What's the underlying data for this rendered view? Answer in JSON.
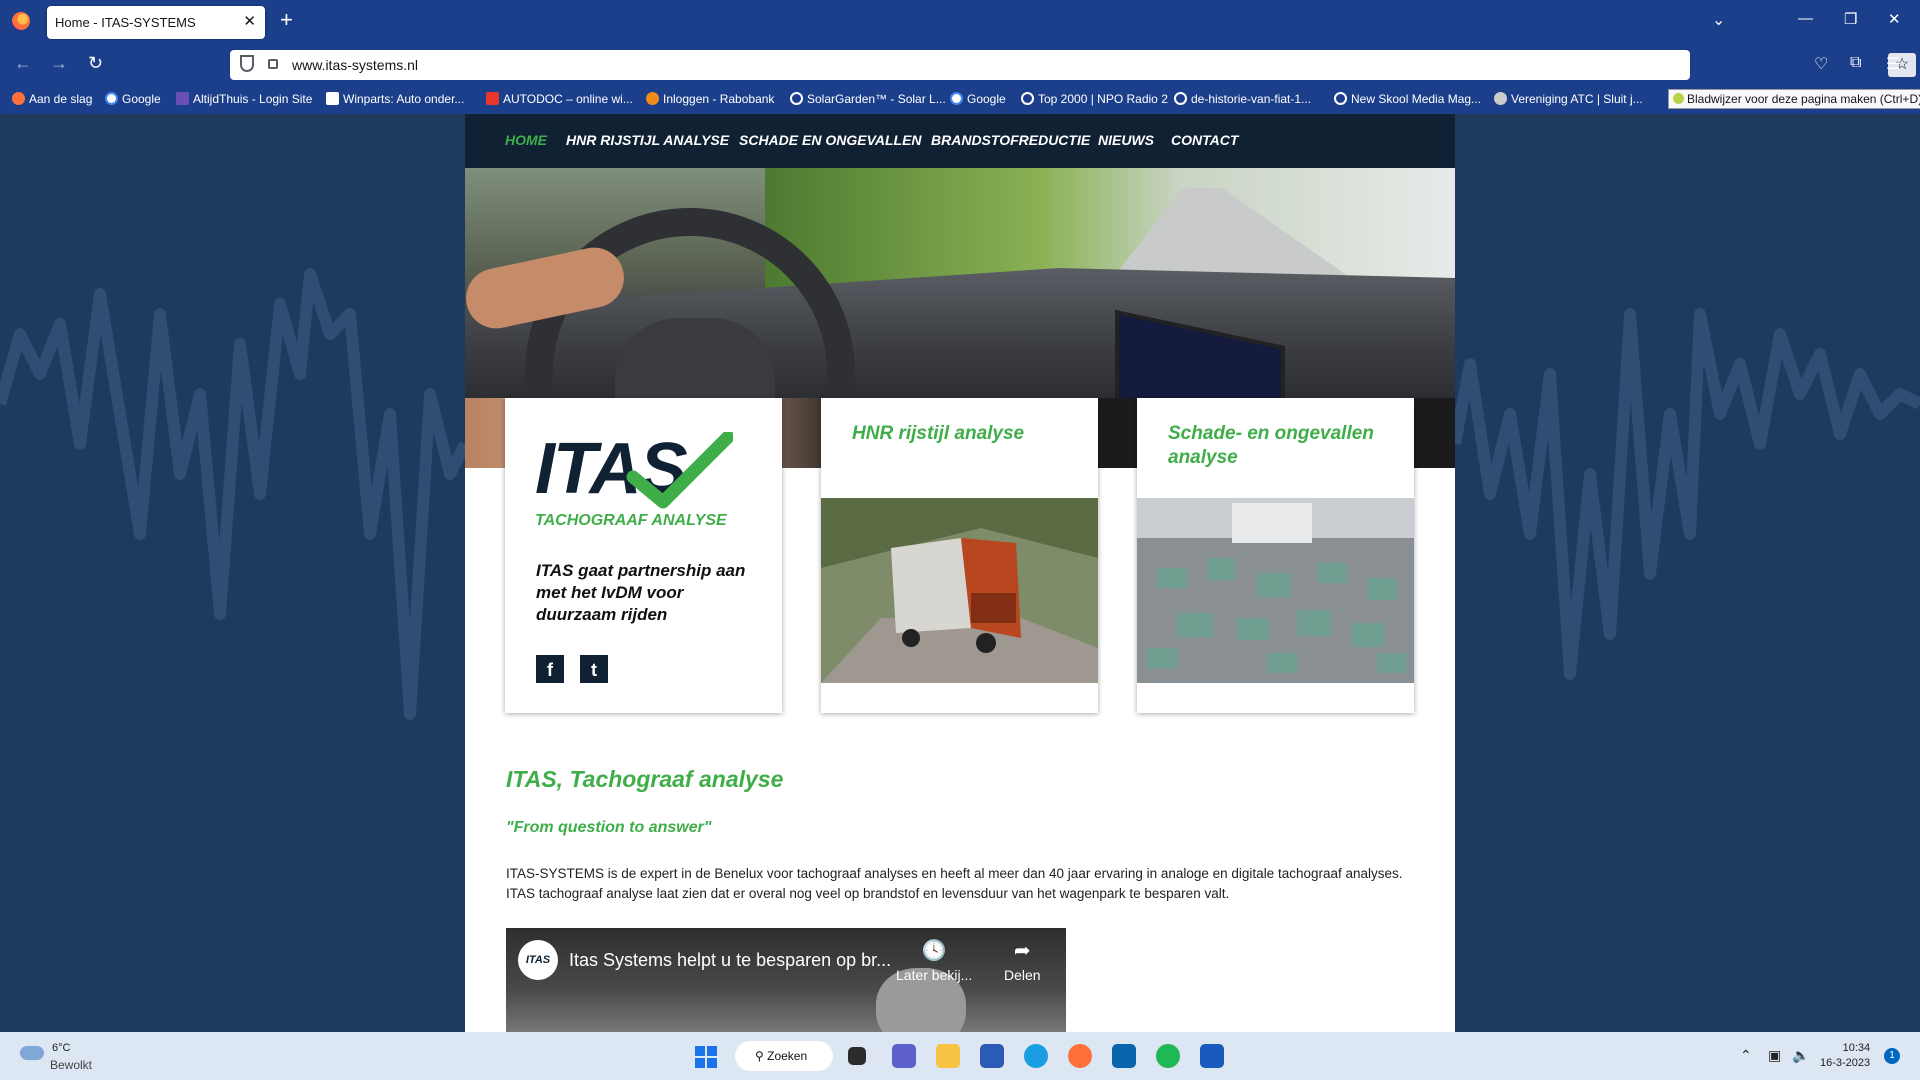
{
  "browser": {
    "tab_title": "Home - ITAS-SYSTEMS",
    "tab_close": "✕",
    "new_tab": "+",
    "url": "www.itas-systems.nl",
    "bookmarks": [
      "Aan de slag",
      "Google",
      "AltijdThuis - Login Site",
      "Winparts: Auto onder...",
      "AUTODOC – online wi...",
      "Inloggen - Rabobank",
      "SolarGarden™ - Solar L...",
      "Google",
      "Top 2000 | NPO Radio 2",
      "de-historie-van-fiat-1...",
      "New Skool Media Mag...",
      "Vereniging ATC | Sluit j..."
    ],
    "tooltip": "Bladwijzer voor deze pagina maken (Ctrl+D)"
  },
  "site": {
    "nav": [
      "HOME",
      "HNR RIJSTIJL ANALYSE",
      "SCHADE EN ONGEVALLEN",
      "BRANDSTOFREDUCTIE",
      "NIEUWS",
      "CONTACT"
    ],
    "logo_text": "ITAS",
    "logo_sub": "TACHOGRAAF ANALYSE",
    "news_text": "ITAS gaat partnership aan met het IvDM voor duurzaam rijden",
    "social": {
      "facebook": "f",
      "twitter": "t"
    },
    "card2_title": "HNR rijstijl analyse",
    "card3_title": "Schade- en ongevallen analyse",
    "heading": "ITAS, Tachograaf analyse",
    "slogan": "\"From question to answer\"",
    "intro": "ITAS-SYSTEMS is de expert in de Benelux voor tachograaf analyses en heeft al meer dan 40 jaar ervaring in analoge en digitale tachograaf analyses. ITAS tachograaf analyse laat zien dat er overal nog veel op brandstof en levensduur van het wagenpark te besparen valt.",
    "video": {
      "channel": "ITAS",
      "title": "Itas Systems helpt u te besparen op br...",
      "later": "Later bekij...",
      "share": "Delen"
    }
  },
  "taskbar": {
    "temp": "6°C",
    "weather": "Bewolkt",
    "search": "Zoeken",
    "time": "10:34",
    "date": "16-3-2023",
    "notifications": "1"
  },
  "colors": {
    "accent_green": "#3fae49",
    "navy": "#0f2132",
    "browser_blue": "#1c3f8c"
  }
}
